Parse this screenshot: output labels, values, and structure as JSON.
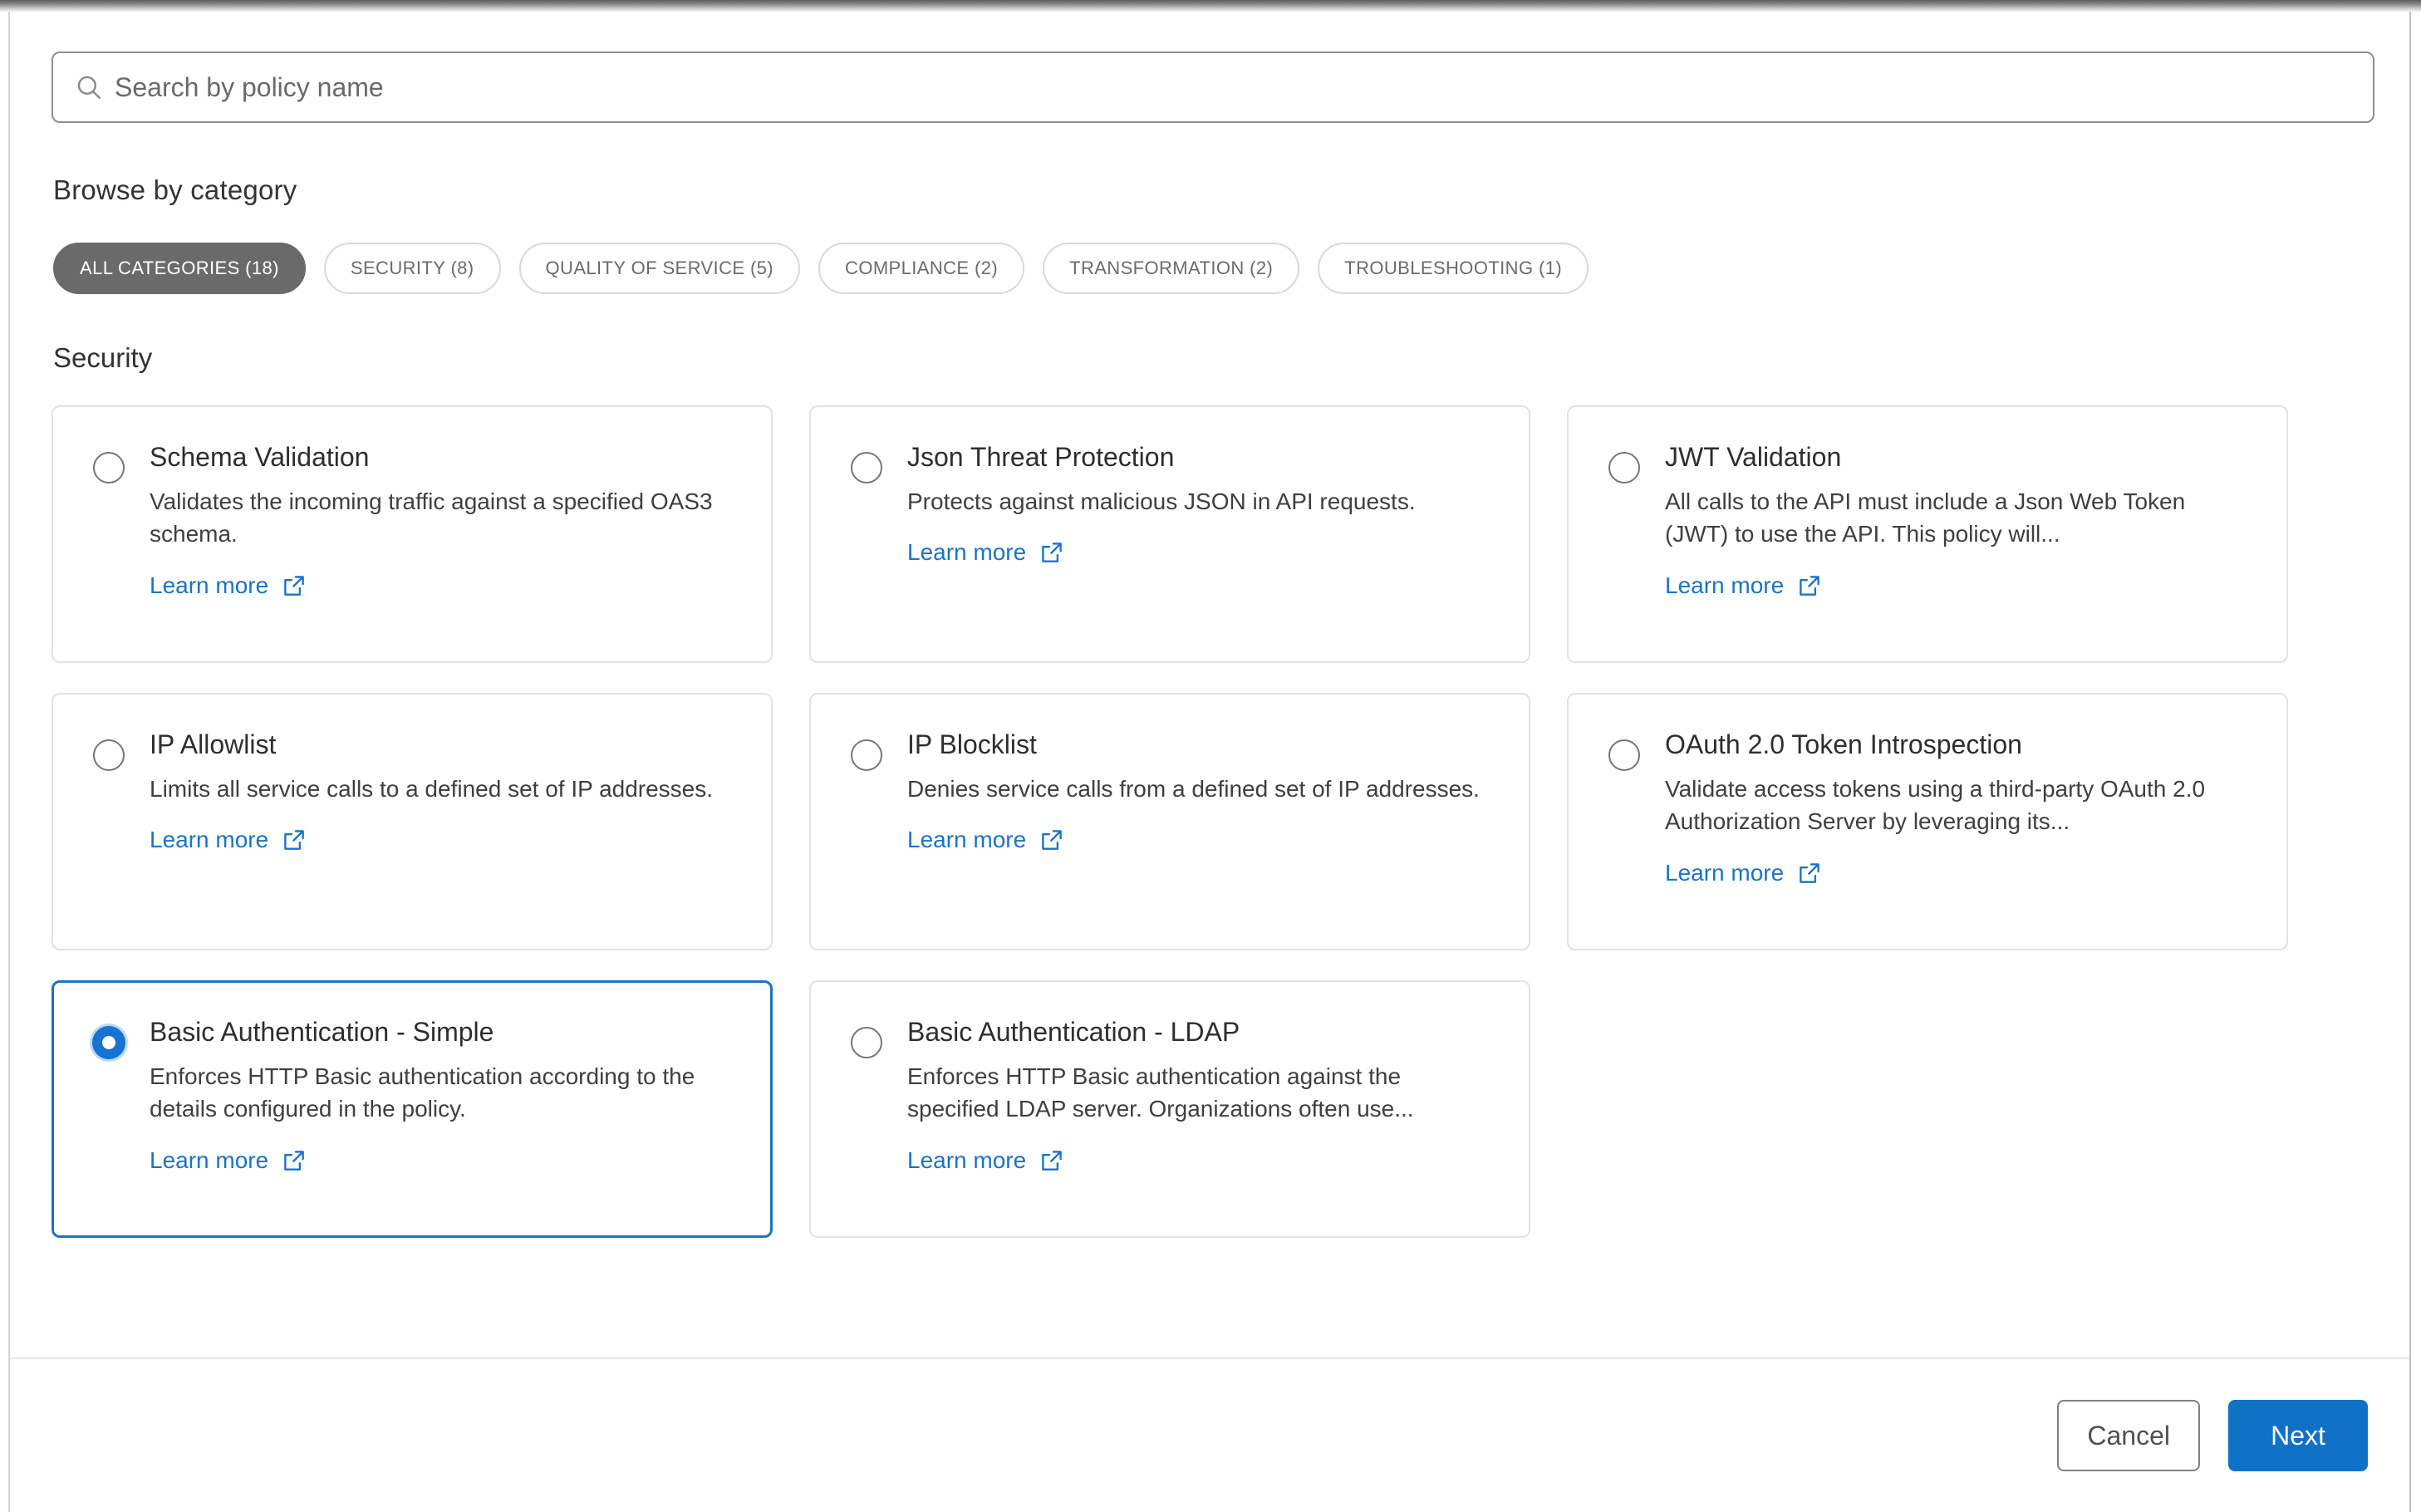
{
  "search": {
    "placeholder": "Search by policy name",
    "value": "",
    "icon": "search-icon"
  },
  "browse": {
    "heading": "Browse by category",
    "chips": [
      {
        "label": "ALL CATEGORIES (18)",
        "active": true
      },
      {
        "label": "SECURITY (8)",
        "active": false
      },
      {
        "label": "QUALITY OF SERVICE (5)",
        "active": false
      },
      {
        "label": "COMPLIANCE (2)",
        "active": false
      },
      {
        "label": "TRANSFORMATION (2)",
        "active": false
      },
      {
        "label": "TROUBLESHOOTING (1)",
        "active": false
      }
    ]
  },
  "section": {
    "title": "Security",
    "learn_more_label": "Learn more",
    "learn_more_icon": "external-link-icon",
    "cards": [
      {
        "title": "Schema Validation",
        "description": "Validates the incoming traffic against a specified OAS3 schema.",
        "selected": false
      },
      {
        "title": "Json Threat Protection",
        "description": "Protects against malicious JSON in API requests.",
        "selected": false
      },
      {
        "title": "JWT Validation",
        "description": "All calls to the API must include a Json Web Token (JWT) to use the API. This policy will...",
        "selected": false
      },
      {
        "title": "IP Allowlist",
        "description": "Limits all service calls to a defined set of IP addresses.",
        "selected": false
      },
      {
        "title": "IP Blocklist",
        "description": "Denies service calls from a defined set of IP addresses.",
        "selected": false
      },
      {
        "title": "OAuth 2.0 Token Introspection",
        "description": "Validate access tokens using a third-party OAuth 2.0 Authorization Server by leveraging its...",
        "selected": false
      },
      {
        "title": "Basic Authentication - Simple",
        "description": "Enforces HTTP Basic authentication according to the details configured in the policy.",
        "selected": true
      },
      {
        "title": "Basic Authentication - LDAP",
        "description": "Enforces HTTP Basic authentication against the specified LDAP server. Organizations often use...",
        "selected": false
      }
    ]
  },
  "footer": {
    "cancel_label": "Cancel",
    "next_label": "Next"
  },
  "colors": {
    "accent_blue": "#1072c6",
    "selected_border": "#1a73c8",
    "chip_active_bg": "#6a6a6a",
    "link_blue": "#1a73c8"
  }
}
